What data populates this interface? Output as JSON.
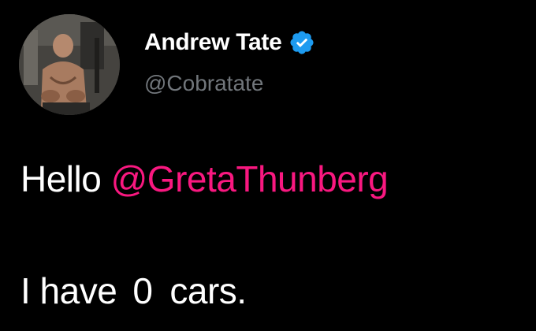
{
  "author": {
    "display_name": "Andrew Tate",
    "handle": "@Cobratate",
    "verified": true,
    "avatar_icon": "profile-photo"
  },
  "tweet": {
    "line1_prefix": "Hello",
    "line1_mention": "@GretaThunberg",
    "line2_part1": "I have",
    "line2_number": "0",
    "line2_part2": "cars."
  },
  "colors": {
    "background": "#000000",
    "text": "#ffffff",
    "handle": "#71767b",
    "mention": "#f91880",
    "verified_badge": "#1d9bf0"
  },
  "icons": {
    "verified": "verified-badge-icon"
  }
}
